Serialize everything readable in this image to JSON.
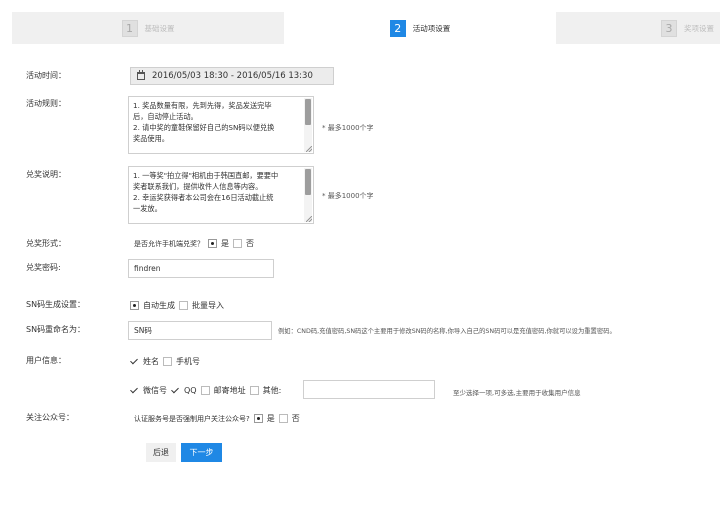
{
  "steps": [
    {
      "num": "1",
      "label": "基础设置"
    },
    {
      "num": "2",
      "label": "活动项设置"
    },
    {
      "num": "3",
      "label": "奖项设置"
    }
  ],
  "time": {
    "label": "活动时间：",
    "value": "2016/05/03 18:30 - 2016/05/16 13:30"
  },
  "rules": {
    "label": "活动规则：",
    "lines": [
      "1. 奖品数量有限，先到先得，奖品发送完毕",
      "后，自动停止活动。",
      "2. 请中奖的童鞋保留好自己的SN码以便兑换",
      "奖品使用。"
    ],
    "hint": "* 最多1000个字"
  },
  "redeem_desc": {
    "label": "兑奖说明：",
    "lines": [
      "1. 一等奖\"拍立得\"相机由于韩国直邮，要要中",
      "奖者联系我们，提供收件人信息等内容。",
      "2. 幸运奖获得者本公司会在16日活动截止统",
      "一发放。"
    ],
    "hint": "* 最多1000个字"
  },
  "redeem_form": {
    "label": "兑奖形式：",
    "question": "是否允许手机端兑奖？",
    "yes": "是",
    "no": "否"
  },
  "redeem_pwd": {
    "label": "兑奖密码:",
    "value": "findren"
  },
  "sn_gen": {
    "label": "SN码生成设置：",
    "auto": "自动生成",
    "bulk": "批量导入"
  },
  "sn_rename": {
    "label": "SN码重命名为：",
    "value": "SN码",
    "hint": "例如：CND码,充值密码,SN码这个主要用于修改SN码的名称,你导入自己的SN码可以是充值密码,你就可以设为重置密码。"
  },
  "user_info": {
    "label": "用户信息：",
    "name": "姓名",
    "phone": "手机号",
    "wechat": "微信号",
    "qq": "QQ",
    "address": "邮寄地址",
    "other": "其他:",
    "other_value": "",
    "hint": "至少选择一项,可多选,主要用于收集用户信息"
  },
  "follow": {
    "label": "关注公众号：",
    "question": "认证服务号是否强制用户关注公众号?",
    "yes": "是",
    "no": "否"
  },
  "buttons": {
    "back": "后退",
    "next": "下一步"
  }
}
